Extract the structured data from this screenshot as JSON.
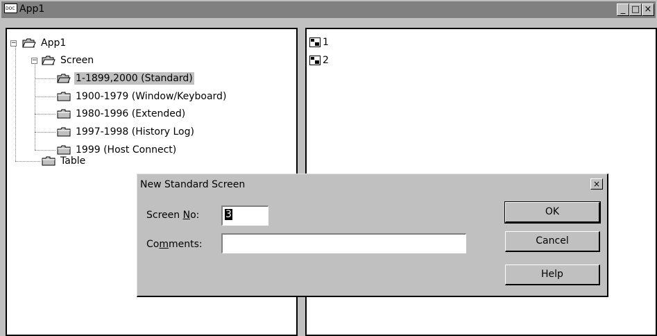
{
  "window": {
    "title": "App1",
    "minimize_glyph": "_",
    "maximize_glyph": "□",
    "close_glyph": "×",
    "icon": "doc-icon"
  },
  "tree": {
    "root_label": "App1",
    "screen_label": "Screen",
    "screen_children": [
      {
        "label": "1-1899,2000 (Standard)",
        "selected": true,
        "open": true
      },
      {
        "label": "1900-1979 (Window/Keyboard)",
        "selected": false
      },
      {
        "label": "1980-1996 (Extended)",
        "selected": false
      },
      {
        "label": "1997-1998 (History Log)",
        "selected": false
      },
      {
        "label": "1999 (Host Connect)",
        "selected": false
      }
    ],
    "table_label": "Table",
    "expander_glyph": "−"
  },
  "list": {
    "items": [
      {
        "label": "1"
      },
      {
        "label": "2"
      }
    ]
  },
  "dialog": {
    "title": "New Standard Screen",
    "close_glyph": "×",
    "screen_no_label_pre": "Screen ",
    "screen_no_label_ul": "N",
    "screen_no_label_post": "o:",
    "screen_no_value": "3",
    "comments_label_pre": "Co",
    "comments_label_ul": "m",
    "comments_label_post": "ments:",
    "comments_value": "",
    "ok_label": "OK",
    "cancel_label": "Cancel",
    "help_label": "Help"
  }
}
